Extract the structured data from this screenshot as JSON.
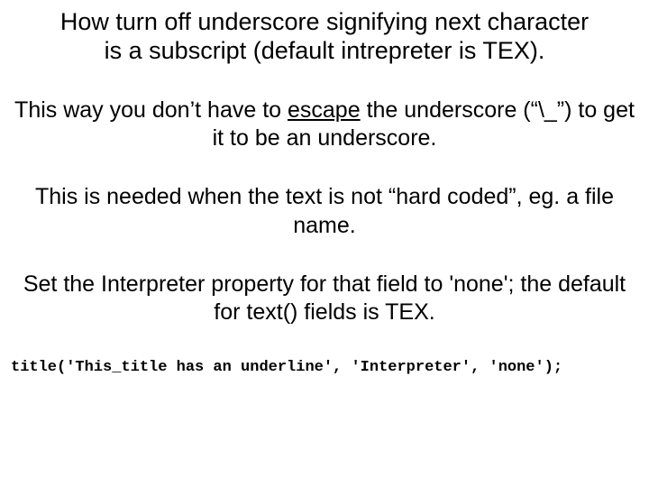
{
  "title_line1": "How turn off underscore signifying next character",
  "title_line2": "is a subscript (default intrepreter is TEX).",
  "p1_prefix": "This way you don’t have to ",
  "p1_link": "escape",
  "p1_suffix": " the underscore (“\\_”) to get it to be an underscore.",
  "p2": "This is needed when the text is not “hard coded”, eg. a file name.",
  "p3": "Set the Interpreter property for that field to 'none'; the default for text() fields is TEX.",
  "code": "title('This_title has an underline', 'Interpreter', 'none');"
}
